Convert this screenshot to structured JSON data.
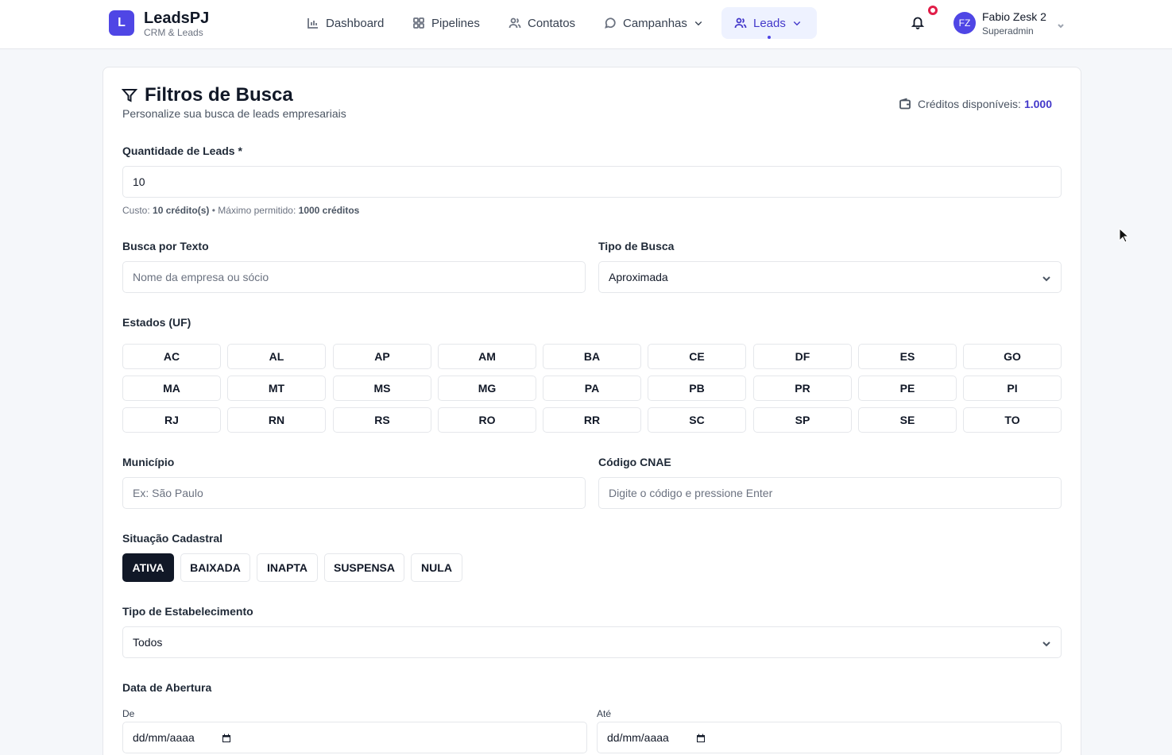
{
  "brand": {
    "logo_letter": "L",
    "name": "LeadsPJ",
    "subtitle": "CRM & Leads"
  },
  "nav": {
    "items": [
      {
        "label": "Dashboard",
        "icon": "bar-chart-icon"
      },
      {
        "label": "Pipelines",
        "icon": "grid-icon"
      },
      {
        "label": "Contatos",
        "icon": "users-icon"
      },
      {
        "label": "Campanhas",
        "icon": "message-circle-icon"
      },
      {
        "label": "Leads",
        "icon": "users-icon",
        "active": true
      }
    ]
  },
  "user": {
    "initials": "FZ",
    "name": "Fabio Zesk 2",
    "role": "Superadmin"
  },
  "header": {
    "title": "Filtros de Busca",
    "subtitle": "Personalize sua busca de leads empresariais",
    "credits_label": "Créditos disponíveis:",
    "credits_value": "1.000"
  },
  "quantity": {
    "label": "Quantidade de Leads *",
    "value": "10",
    "hint_prefix": "Custo:",
    "hint_cost": "10 crédito(s)",
    "hint_mid": "• Máximo permitido:",
    "hint_max": "1000 créditos"
  },
  "text_search": {
    "label": "Busca por Texto",
    "placeholder": "Nome da empresa ou sócio"
  },
  "search_type": {
    "label": "Tipo de Busca",
    "value": "Aproximada"
  },
  "states": {
    "label": "Estados (UF)",
    "items": [
      "AC",
      "AL",
      "AP",
      "AM",
      "BA",
      "CE",
      "DF",
      "ES",
      "GO",
      "MA",
      "MT",
      "MS",
      "MG",
      "PA",
      "PB",
      "PR",
      "PE",
      "PI",
      "RJ",
      "RN",
      "RS",
      "RO",
      "RR",
      "SC",
      "SP",
      "SE",
      "TO"
    ]
  },
  "municipio": {
    "label": "Município",
    "placeholder": "Ex: São Paulo"
  },
  "cnae": {
    "label": "Código CNAE",
    "placeholder": "Digite o código e pressione Enter"
  },
  "situacao": {
    "label": "Situação Cadastral",
    "items": [
      "ATIVA",
      "BAIXADA",
      "INAPTA",
      "SUSPENSA",
      "NULA"
    ],
    "selected": "ATIVA"
  },
  "estabelecimento": {
    "label": "Tipo de Estabelecimento",
    "value": "Todos"
  },
  "abertura": {
    "label": "Data de Abertura",
    "from_label": "De",
    "to_label": "Até",
    "from_placeholder": "dd/mm/aaaa",
    "to_placeholder": "dd/mm/aaaa"
  }
}
